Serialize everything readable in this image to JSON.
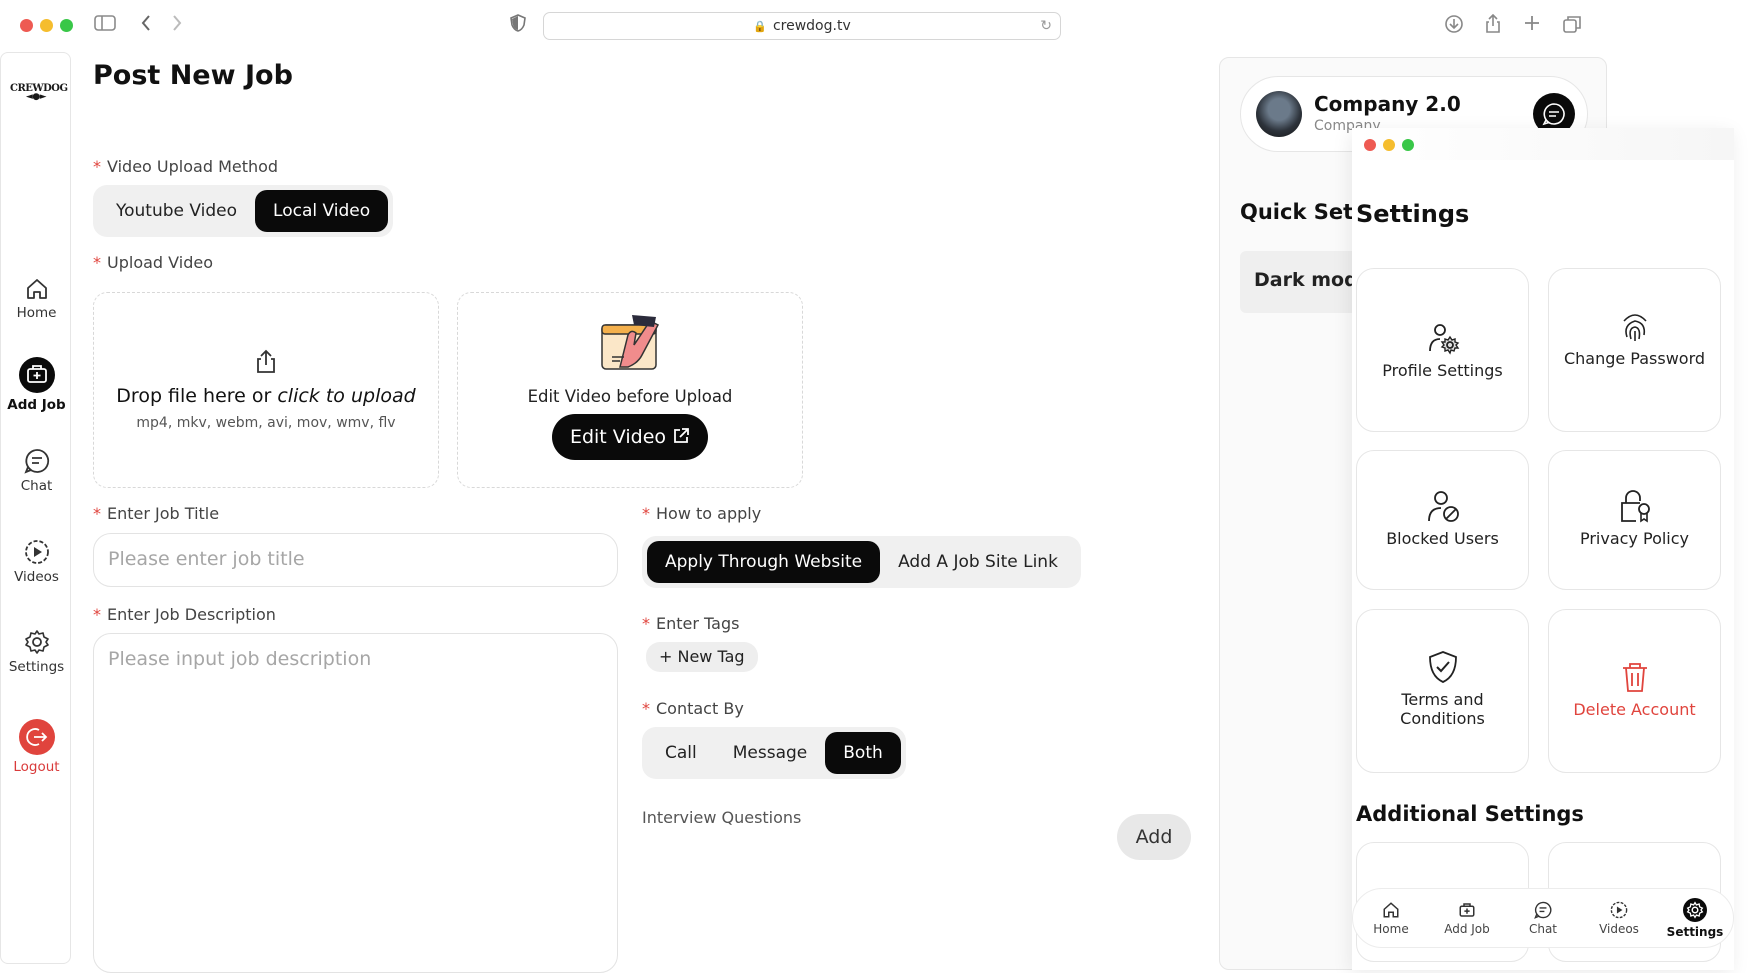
{
  "browser": {
    "url": "crewdog.tv"
  },
  "sidebar": {
    "logo_text": "CREWDOG",
    "items": [
      {
        "label": "Home",
        "icon": "home-icon"
      },
      {
        "label": "Add Job",
        "icon": "briefcase-plus-icon"
      },
      {
        "label": "Chat",
        "icon": "chat-icon"
      },
      {
        "label": "Videos",
        "icon": "play-circle-icon"
      },
      {
        "label": "Settings",
        "icon": "gear-icon"
      },
      {
        "label": "Logout",
        "icon": "logout-icon"
      }
    ],
    "active": "Add Job"
  },
  "form": {
    "page_title": "Post New Job",
    "video_method_label": "Video Upload Method",
    "video_method_options": [
      "Youtube Video",
      "Local Video"
    ],
    "video_method_selected": "Local Video",
    "upload_label": "Upload Video",
    "drop_text_prefix": "Drop file here or ",
    "drop_text_link": "click to upload",
    "drop_hint": "mp4, mkv, webm, avi, mov, wmv, flv",
    "edit_caption": "Edit Video before Upload",
    "edit_button": "Edit Video",
    "job_title_label": "Enter Job Title",
    "job_title_placeholder": "Please enter job title",
    "job_desc_label": "Enter Job Description",
    "job_desc_placeholder": "Please input job description",
    "how_to_apply_label": "How to apply",
    "how_to_apply_options": [
      "Apply Through Website",
      "Add A Job Site Link"
    ],
    "how_to_apply_selected": "Apply Through Website",
    "tags_label": "Enter Tags",
    "new_tag_button": "+ New Tag",
    "contact_label": "Contact By",
    "contact_options": [
      "Call",
      "Message",
      "Both"
    ],
    "contact_selected": "Both",
    "interview_label": "Interview Questions",
    "add_button": "Add"
  },
  "right_panel": {
    "company_name": "Company 2.0",
    "company_sub": "Company",
    "quick_settings_title": "Quick Setti",
    "dark_mode_label": "Dark mode"
  },
  "settings_overlay": {
    "title": "Settings",
    "cards": [
      {
        "label": "Profile Settings",
        "icon": "user-gear-icon"
      },
      {
        "label": "Change Password",
        "icon": "fingerprint-icon"
      },
      {
        "label": "Blocked Users",
        "icon": "user-blocked-icon"
      },
      {
        "label": "Privacy Policy",
        "icon": "lock-badge-icon"
      },
      {
        "label": "Terms and Conditions",
        "icon": "shield-check-icon"
      },
      {
        "label": "Delete Account",
        "icon": "trash-icon"
      }
    ],
    "additional_title": "Additional Settings",
    "bottom_nav": [
      "Home",
      "Add Job",
      "Chat",
      "Videos",
      "Settings"
    ],
    "bottom_nav_active": "Settings"
  },
  "colors": {
    "accent": "#0a0a0a",
    "danger": "#e0443d",
    "muted": "#a6a6a6"
  }
}
